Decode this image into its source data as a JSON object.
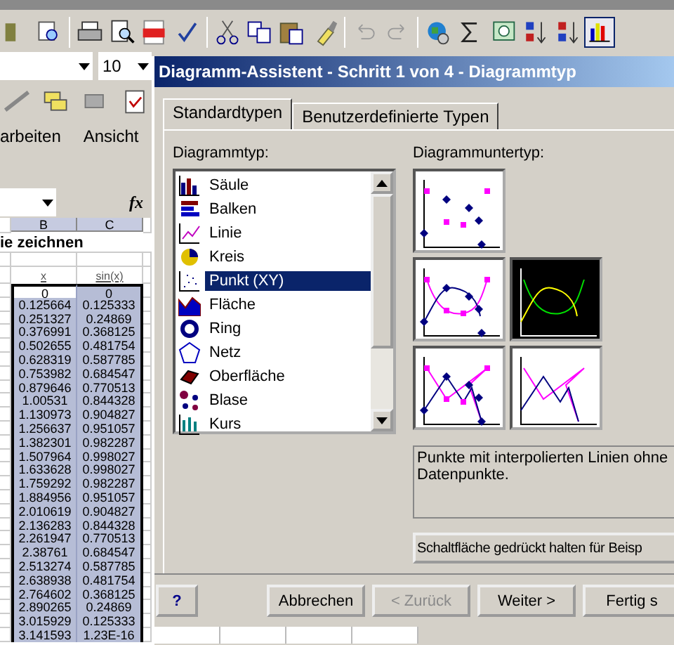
{
  "toolbar": {
    "font_size": "10"
  },
  "menu": [
    {
      "label": "arbeiten"
    },
    {
      "label": "Ansicht"
    }
  ],
  "formula_bar": {
    "function_label": "fx"
  },
  "sheet": {
    "columns": [
      "B",
      "C"
    ],
    "title": "ie zeichnen",
    "headers": [
      "x",
      "sin(x)"
    ],
    "rows": [
      {
        "cells": [
          "0",
          "0"
        ],
        "active": true,
        "selected": true
      },
      {
        "cells": [
          "0.125664",
          "0.125333"
        ],
        "active": false,
        "selected": true
      },
      {
        "cells": [
          "0.251327",
          "0.24869"
        ],
        "active": false,
        "selected": true
      },
      {
        "cells": [
          "0.376991",
          "0.368125"
        ],
        "active": false,
        "selected": true
      },
      {
        "cells": [
          "0.502655",
          "0.481754"
        ],
        "active": false,
        "selected": true
      },
      {
        "cells": [
          "0.628319",
          "0.587785"
        ],
        "active": false,
        "selected": true
      },
      {
        "cells": [
          "0.753982",
          "0.684547"
        ],
        "active": false,
        "selected": true
      },
      {
        "cells": [
          "0.879646",
          "0.770513"
        ],
        "active": false,
        "selected": true
      },
      {
        "cells": [
          "1.00531",
          "0.844328"
        ],
        "active": false,
        "selected": true
      },
      {
        "cells": [
          "1.130973",
          "0.904827"
        ],
        "active": false,
        "selected": true
      },
      {
        "cells": [
          "1.256637",
          "0.951057"
        ],
        "active": false,
        "selected": true
      },
      {
        "cells": [
          "1.382301",
          "0.982287"
        ],
        "active": false,
        "selected": true
      },
      {
        "cells": [
          "1.507964",
          "0.998027"
        ],
        "active": false,
        "selected": true
      },
      {
        "cells": [
          "1.633628",
          "0.998027"
        ],
        "active": false,
        "selected": true
      },
      {
        "cells": [
          "1.759292",
          "0.982287"
        ],
        "active": false,
        "selected": true
      },
      {
        "cells": [
          "1.884956",
          "0.951057"
        ],
        "active": false,
        "selected": true
      },
      {
        "cells": [
          "2.010619",
          "0.904827"
        ],
        "active": false,
        "selected": true
      },
      {
        "cells": [
          "2.136283",
          "0.844328"
        ],
        "active": false,
        "selected": true
      },
      {
        "cells": [
          "2.261947",
          "0.770513"
        ],
        "active": false,
        "selected": true
      },
      {
        "cells": [
          "2.38761",
          "0.684547"
        ],
        "active": false,
        "selected": true
      },
      {
        "cells": [
          "2.513274",
          "0.587785"
        ],
        "active": false,
        "selected": true
      },
      {
        "cells": [
          "2.638938",
          "0.481754"
        ],
        "active": false,
        "selected": true
      },
      {
        "cells": [
          "2.764602",
          "0.368125"
        ],
        "active": false,
        "selected": true
      },
      {
        "cells": [
          "2.890265",
          "0.24869"
        ],
        "active": false,
        "selected": true
      },
      {
        "cells": [
          "3.015929",
          "0.125333"
        ],
        "active": false,
        "selected": true
      },
      {
        "cells": [
          "3.141593",
          "1.23E-16"
        ],
        "active": false,
        "selected": true
      }
    ]
  },
  "dialog": {
    "title": "Diagramm-Assistent - Schritt 1 von 4 - Diagrammtyp",
    "tabs": [
      {
        "label": "Standardtypen",
        "selected": true
      },
      {
        "label": "Benutzerdefinierte Typen",
        "selected": false
      }
    ],
    "type_label": "Diagrammtyp:",
    "types": [
      {
        "label": "Säule",
        "kind": "column",
        "selected": false
      },
      {
        "label": "Balken",
        "kind": "bar",
        "selected": false
      },
      {
        "label": "Linie",
        "kind": "line",
        "selected": false
      },
      {
        "label": "Kreis",
        "kind": "pie",
        "selected": false
      },
      {
        "label": "Punkt (XY)",
        "kind": "scatter",
        "selected": true
      },
      {
        "label": "Fläche",
        "kind": "area",
        "selected": false
      },
      {
        "label": "Ring",
        "kind": "doughnut",
        "selected": false
      },
      {
        "label": "Netz",
        "kind": "radar",
        "selected": false
      },
      {
        "label": "Oberfläche",
        "kind": "surface",
        "selected": false
      },
      {
        "label": "Blase",
        "kind": "bubble",
        "selected": false
      },
      {
        "label": "Kurs",
        "kind": "stock",
        "selected": false
      }
    ],
    "subtype_label": "Diagrammuntertyp:",
    "subtypes": [
      {
        "kind": "markers",
        "selected": false
      },
      {
        "kind": "smooth-markers",
        "selected": false
      },
      {
        "kind": "smooth",
        "selected": true
      },
      {
        "kind": "lines-markers",
        "selected": false
      },
      {
        "kind": "lines",
        "selected": false
      }
    ],
    "description": "Punkte mit interpolierten Linien ohne Datenpunkte.",
    "preview_button": "Schaltfläche gedrückt halten für Beisp",
    "help_button": "?",
    "buttons": [
      {
        "label": "Abbrechen",
        "disabled": false
      },
      {
        "label": "< Zurück",
        "disabled": true
      },
      {
        "label": "Weiter >",
        "disabled": false
      },
      {
        "label": "Fertig s",
        "disabled": false
      }
    ]
  }
}
